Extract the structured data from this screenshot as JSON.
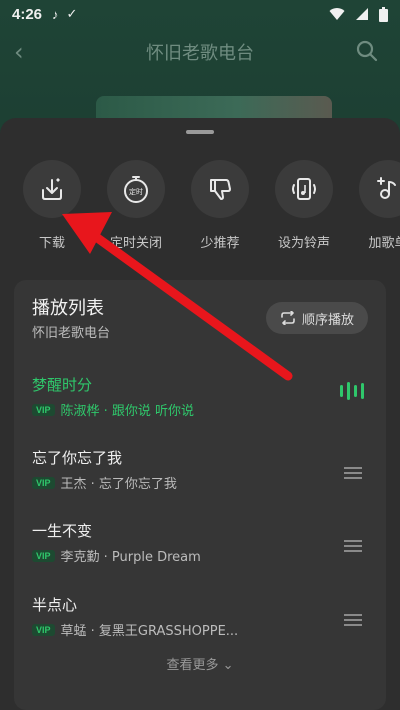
{
  "status_bar": {
    "time": "4:26"
  },
  "background": {
    "title": "怀旧老歌电台",
    "back_icon": "chevron-left-icon",
    "search_icon": "search-icon"
  },
  "actions": [
    {
      "label": "下载",
      "icon": "download-icon"
    },
    {
      "label": "定时关闭",
      "icon": "timer-icon",
      "icon_text": "定时"
    },
    {
      "label": "少推荐",
      "icon": "thumbs-down-icon"
    },
    {
      "label": "设为铃声",
      "icon": "ringtone-icon"
    },
    {
      "label": "加歌单",
      "icon": "add-to-playlist-icon"
    }
  ],
  "playlist": {
    "title": "播放列表",
    "subtitle": "怀旧老歌电台",
    "mode_label": "顺序播放",
    "vip_label": "VIP",
    "songs": [
      {
        "name": "梦醒时分",
        "artist": "陈淑桦 · 跟你说 听你说",
        "playing": true
      },
      {
        "name": "忘了你忘了我",
        "artist": "王杰 · 忘了你忘了我",
        "playing": false
      },
      {
        "name": "一生不变",
        "artist": "李克勤 · Purple Dream",
        "playing": false
      },
      {
        "name": "半点心",
        "artist": "草蜢 · 复黑王GRASSHOPPE...",
        "playing": false
      }
    ],
    "more_label": "查看更多"
  },
  "colors": {
    "accent_green": "#2fc76b",
    "sheet_bg": "#2e2e2e",
    "card_bg": "#363636",
    "annotation_red": "#e8161c"
  }
}
